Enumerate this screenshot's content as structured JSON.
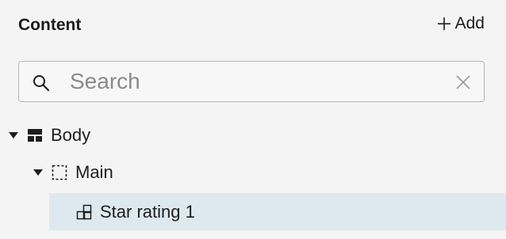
{
  "header": {
    "title": "Content",
    "add_label": "Add"
  },
  "search": {
    "placeholder": "Search",
    "value": ""
  },
  "tree": {
    "body": {
      "label": "Body",
      "expanded": true
    },
    "main": {
      "label": "Main",
      "expanded": true
    },
    "star_rating": {
      "label": "Star rating 1",
      "selected": true
    }
  },
  "colors": {
    "selected_row": "#dde9ee",
    "background": "#f4f4f4",
    "border": "#b4b4b4"
  }
}
